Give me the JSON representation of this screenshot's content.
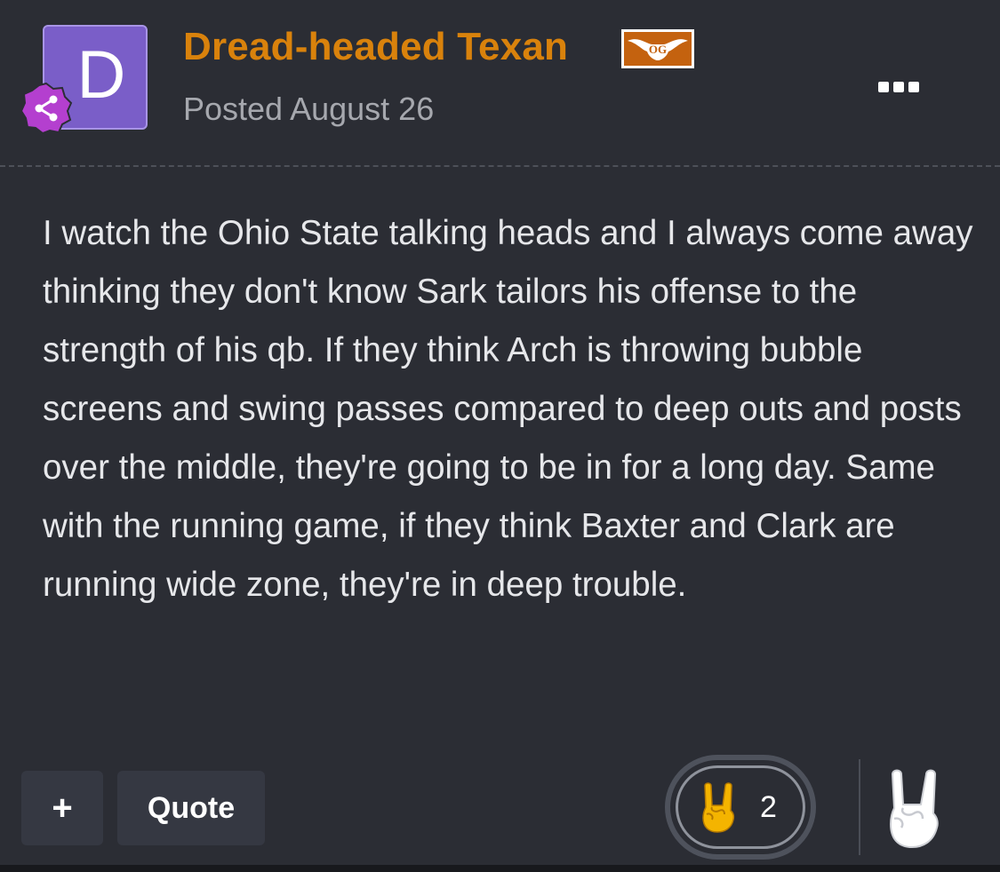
{
  "post": {
    "author_initial": "D",
    "author_name": "Dread-headed Texan",
    "flair_text": "OG",
    "posted": "Posted August 26",
    "body": "I watch the Ohio State talking heads and I always come away thinking they don't know Sark tailors his offense to the strength of his qb. If they think Arch is throwing bubble screens and swing passes compared to deep outs and posts over the middle, they're going to be in for a long day. Same with the running game, if they think Baxter and Clark are running wide zone, they're in deep trouble."
  },
  "actions": {
    "plus_label": "+",
    "quote_label": "Quote"
  },
  "reaction": {
    "icon": "horns-hand-icon",
    "count": "2"
  },
  "colors": {
    "background": "#2b2d34",
    "author": "#d9820c",
    "avatar": "#7a5ec8",
    "badge": "#b43fcf",
    "text": "#e6e7ea",
    "muted": "#a6a8ae"
  }
}
